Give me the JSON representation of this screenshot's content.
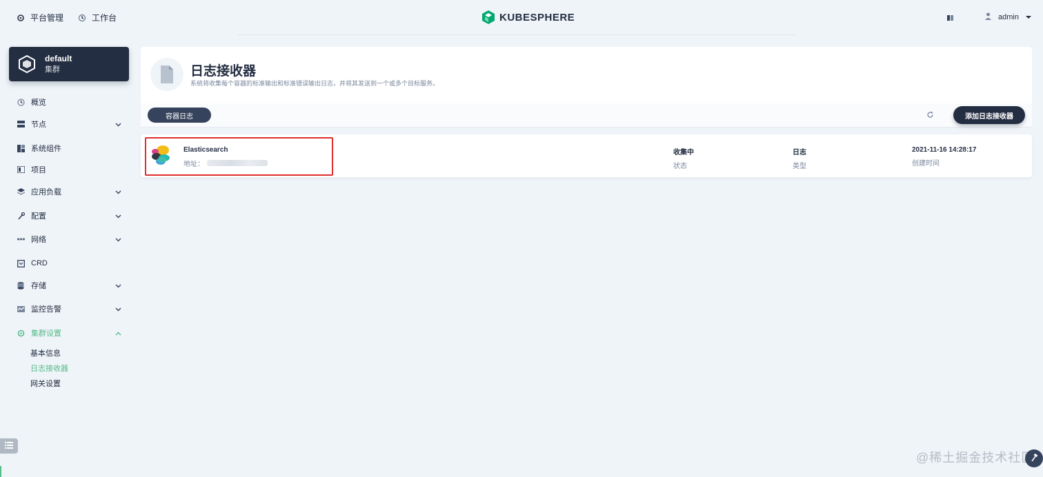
{
  "header": {
    "platform_label": "平台管理",
    "workbench_label": "工作台",
    "brand": "KUBESPHERE",
    "username": "admin"
  },
  "cluster": {
    "name": "default",
    "type": "集群"
  },
  "sidebar": {
    "items": [
      {
        "label": "概览"
      },
      {
        "label": "节点"
      },
      {
        "label": "系统组件"
      },
      {
        "label": "项目"
      },
      {
        "label": "应用负载"
      },
      {
        "label": "配置"
      },
      {
        "label": "网络"
      },
      {
        "label": "CRD"
      },
      {
        "label": "存储"
      },
      {
        "label": "监控告警"
      },
      {
        "label": "集群设置"
      }
    ],
    "sub_items": [
      {
        "label": "基本信息"
      },
      {
        "label": "日志接收器"
      },
      {
        "label": "网关设置"
      }
    ]
  },
  "banner": {
    "title": "日志接收器",
    "description": "系统将收集每个容器的标准输出和标准错误输出日志，并将其发送到一个或多个目标服务。"
  },
  "toolbar": {
    "tab_label": "容器日志",
    "add_label": "添加日志接收器"
  },
  "receiver": {
    "name": "Elasticsearch",
    "address_label": "地址：",
    "status_value": "收集中",
    "status_key": "状态",
    "type_value": "日志",
    "type_key": "类型",
    "created_value": "2021-11-16 14:28:17",
    "created_key": "创建时间"
  },
  "watermark": "@稀土掘金技术社区",
  "colors": {
    "accent": "#55bc8a",
    "dark": "#242e42",
    "highlight": "#e02d2d"
  }
}
